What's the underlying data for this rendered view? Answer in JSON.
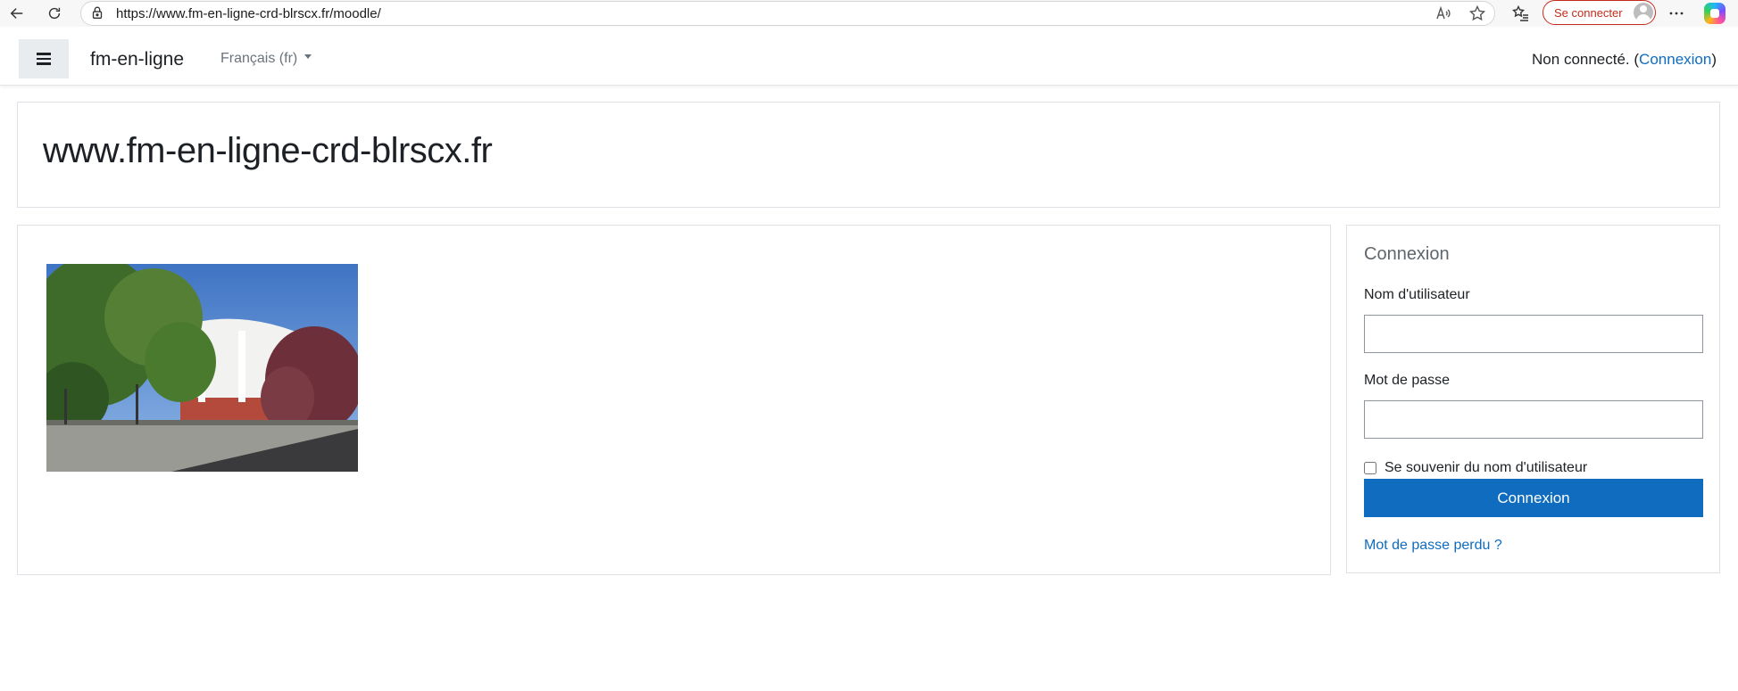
{
  "browser": {
    "url": "https://www.fm-en-ligne-crd-blrscx.fr/moodle/",
    "signin_label": "Se connecter"
  },
  "navbar": {
    "site_name": "fm-en-ligne",
    "language": "Français (fr)",
    "login_status_prefix": "Non connecté. (",
    "login_link": "Connexion",
    "login_status_suffix": ")"
  },
  "header": {
    "title": "www.fm-en-ligne-crd-blrscx.fr"
  },
  "login_block": {
    "title": "Connexion",
    "username_label": "Nom d'utilisateur",
    "username_value": "",
    "password_label": "Mot de passe",
    "password_value": "",
    "remember_label": "Se souvenir du nom d'utilisateur",
    "remember_checked": false,
    "submit_label": "Connexion",
    "forgot_link": "Mot de passe perdu ?"
  },
  "colors": {
    "primary": "#0f6cbf",
    "signin_red": "#c42b1c"
  }
}
